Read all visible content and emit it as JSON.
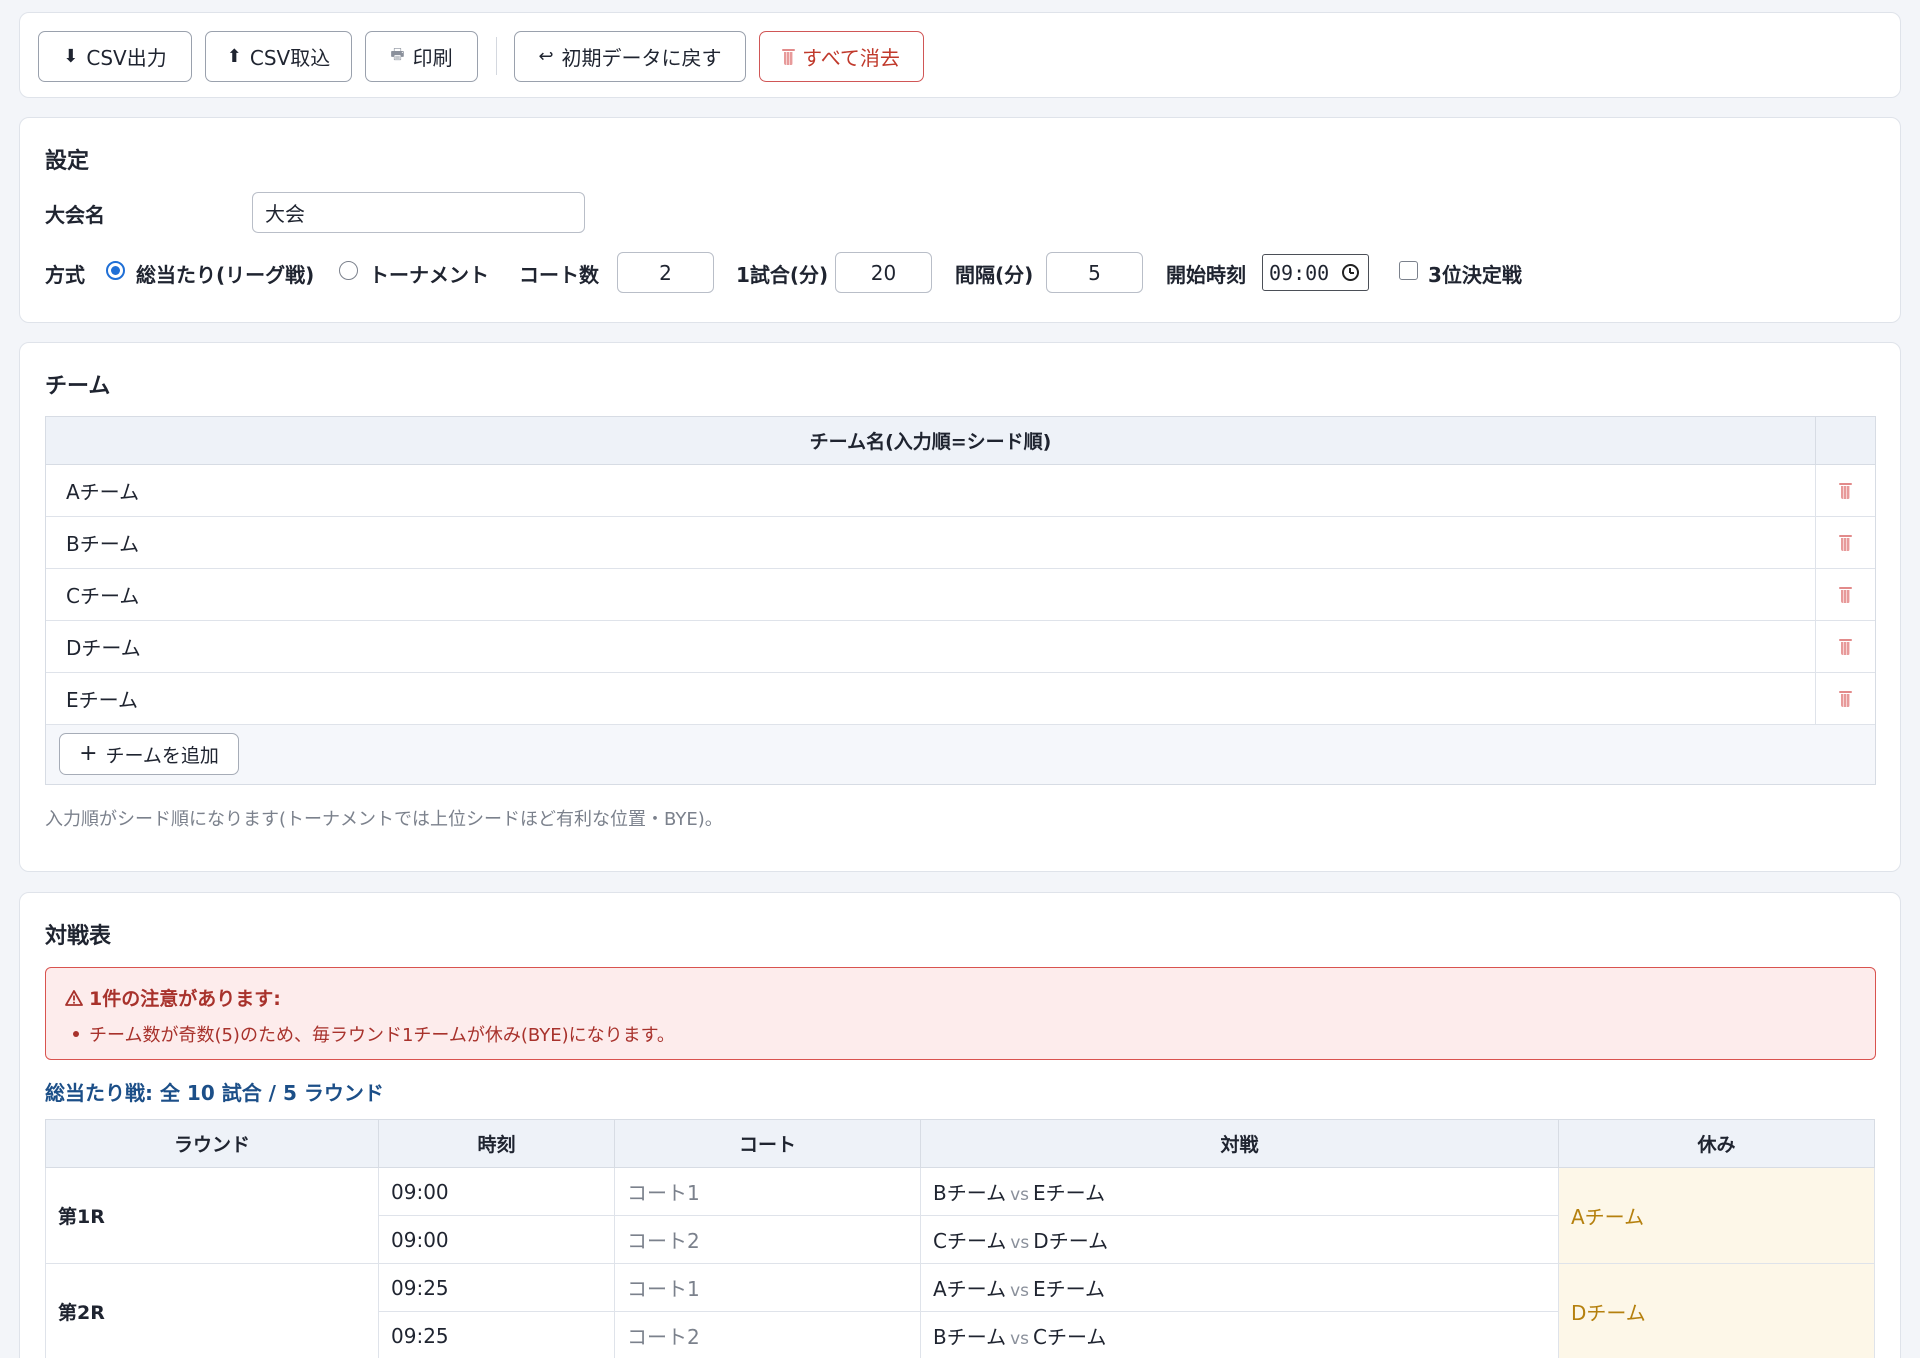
{
  "toolbar": {
    "csv_export": "CSV出力",
    "csv_import": "CSV取込",
    "print": "印刷",
    "reset": "初期データに戻す",
    "clear_all": "すべて消去"
  },
  "settings": {
    "title": "設定",
    "tournament_name_label": "大会名",
    "tournament_name_value": "大会",
    "format_label": "方式",
    "format_league": "総当たり(リーグ戦)",
    "format_tournament": "トーナメント",
    "courts_label": "コート数",
    "courts_value": "2",
    "match_minutes_label": "1試合(分)",
    "match_minutes_value": "20",
    "interval_label": "間隔(分)",
    "interval_value": "5",
    "start_time_label": "開始時刻",
    "start_time_value": "09:00",
    "third_place_label": "3位決定戦"
  },
  "teams": {
    "title": "チーム",
    "column_header": "チーム名(入力順=シード順)",
    "rows": [
      "Aチーム",
      "Bチーム",
      "Cチーム",
      "Dチーム",
      "Eチーム"
    ],
    "add_button": "チームを追加",
    "hint": "入力順がシード順になります(トーナメントでは上位シードほど有利な位置・BYE)。"
  },
  "schedule": {
    "title": "対戦表",
    "warning_title": "1件の注意があります:",
    "warning_item": "チーム数が奇数(5)のため、毎ラウンド1チームが休み(BYE)になります。",
    "summary": "総当たり戦: 全 10 試合 / 5 ラウンド",
    "headers": {
      "round": "ラウンド",
      "time": "時刻",
      "court": "コート",
      "match": "対戦",
      "rest": "休み"
    },
    "vs": "vs",
    "rounds": [
      {
        "label": "第1R",
        "rest": "Aチーム",
        "matches": [
          {
            "time": "09:00",
            "court": "コート1",
            "home": "Bチーム",
            "away": "Eチーム"
          },
          {
            "time": "09:00",
            "court": "コート2",
            "home": "Cチーム",
            "away": "Dチーム"
          }
        ]
      },
      {
        "label": "第2R",
        "rest": "Dチーム",
        "matches": [
          {
            "time": "09:25",
            "court": "コート1",
            "home": "Aチーム",
            "away": "Eチーム"
          },
          {
            "time": "09:25",
            "court": "コート2",
            "home": "Bチーム",
            "away": "Cチーム"
          }
        ]
      }
    ]
  }
}
